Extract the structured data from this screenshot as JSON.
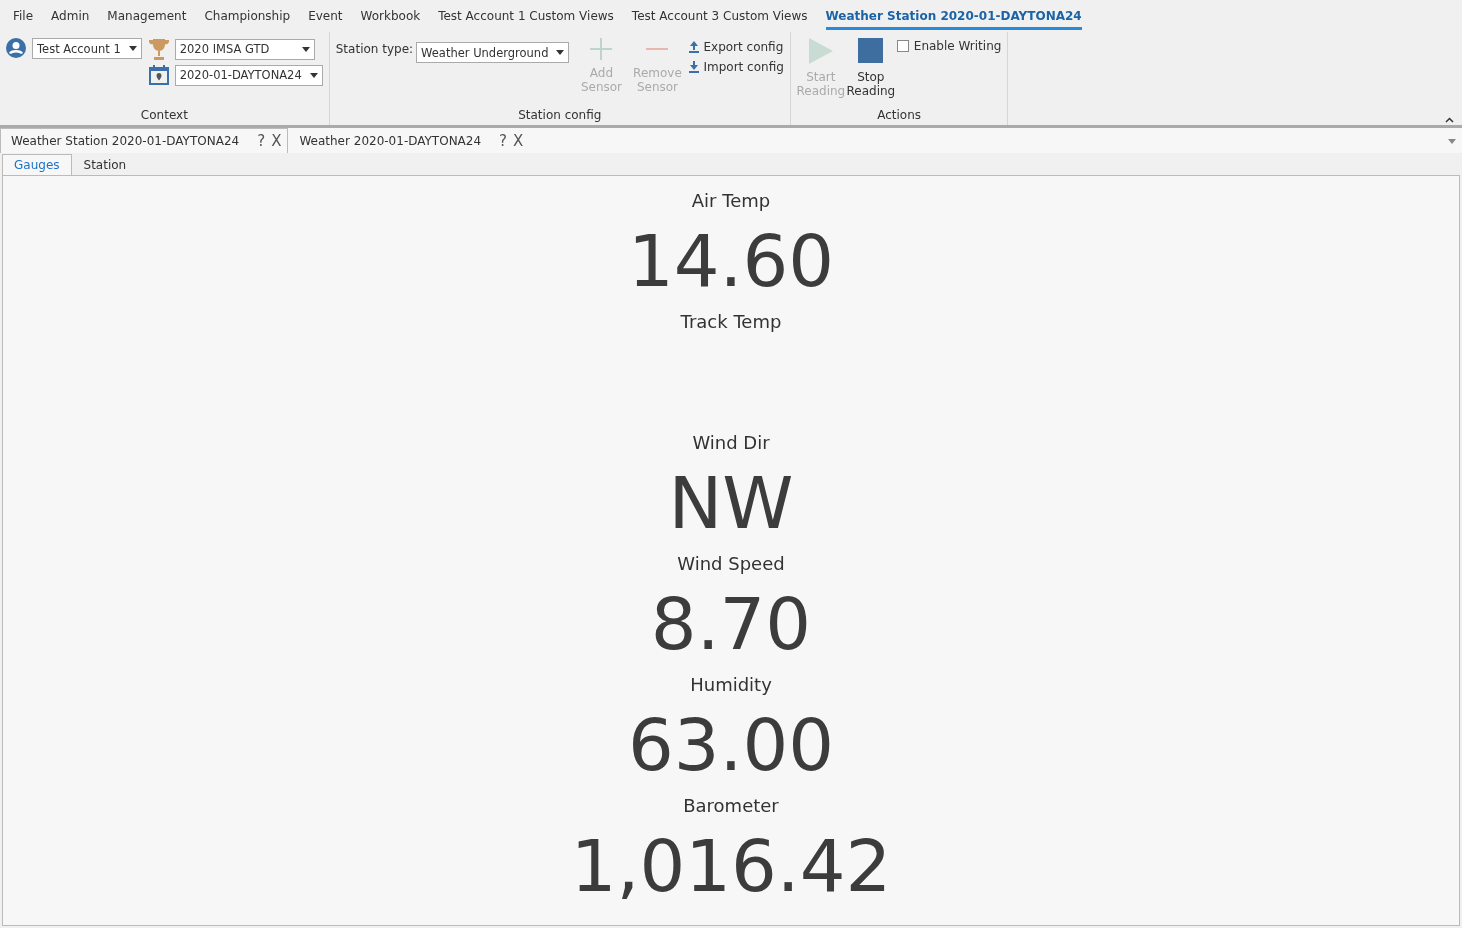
{
  "menu": [
    {
      "label": "File",
      "selected": false
    },
    {
      "label": "Admin",
      "selected": false
    },
    {
      "label": "Management",
      "selected": false
    },
    {
      "label": "Championship",
      "selected": false
    },
    {
      "label": "Event",
      "selected": false
    },
    {
      "label": "Workbook",
      "selected": false
    },
    {
      "label": "Test Account 1 Custom Views",
      "selected": false
    },
    {
      "label": "Test Account 3 Custom Views",
      "selected": false
    },
    {
      "label": "Weather Station 2020-01-DAYTONA24",
      "selected": true
    }
  ],
  "context": {
    "account": "Test Account 1",
    "championship": "2020 IMSA GTD",
    "event": "2020-01-DAYTONA24",
    "group_label": "Context"
  },
  "station_config": {
    "station_type_label": "Station type:",
    "station_type": "Weather Underground",
    "add_sensor": {
      "label": "Add Sensor",
      "disabled": true
    },
    "remove_sensor": {
      "label": "Remove Sensor",
      "disabled": true
    },
    "export": "Export config",
    "import": "Import config",
    "group_label": "Station config"
  },
  "actions": {
    "start": {
      "label": "Start Reading",
      "disabled": true
    },
    "stop": {
      "label": "Stop Reading",
      "disabled": false
    },
    "enable_writing": {
      "label": "Enable Writing",
      "checked": false
    },
    "group_label": "Actions"
  },
  "doc_tabs": [
    {
      "title": "Weather Station 2020-01-DAYTONA24",
      "help": "?",
      "close": "X",
      "selected": true
    },
    {
      "title": "Weather 2020-01-DAYTONA24",
      "help": "?",
      "close": "X",
      "selected": false
    }
  ],
  "sub_tabs": [
    {
      "label": "Gauges",
      "selected": true
    },
    {
      "label": "Station",
      "selected": false
    }
  ],
  "gauges": [
    {
      "label": "Air Temp",
      "value": "14.60"
    },
    {
      "label": "Track Temp"
    },
    {
      "label": "Wind Dir",
      "value": "NW"
    },
    {
      "label": "Wind Speed",
      "value": "8.70"
    },
    {
      "label": "Humidity",
      "value": "63.00"
    },
    {
      "label": "Barometer",
      "value": "1,016.42"
    }
  ]
}
